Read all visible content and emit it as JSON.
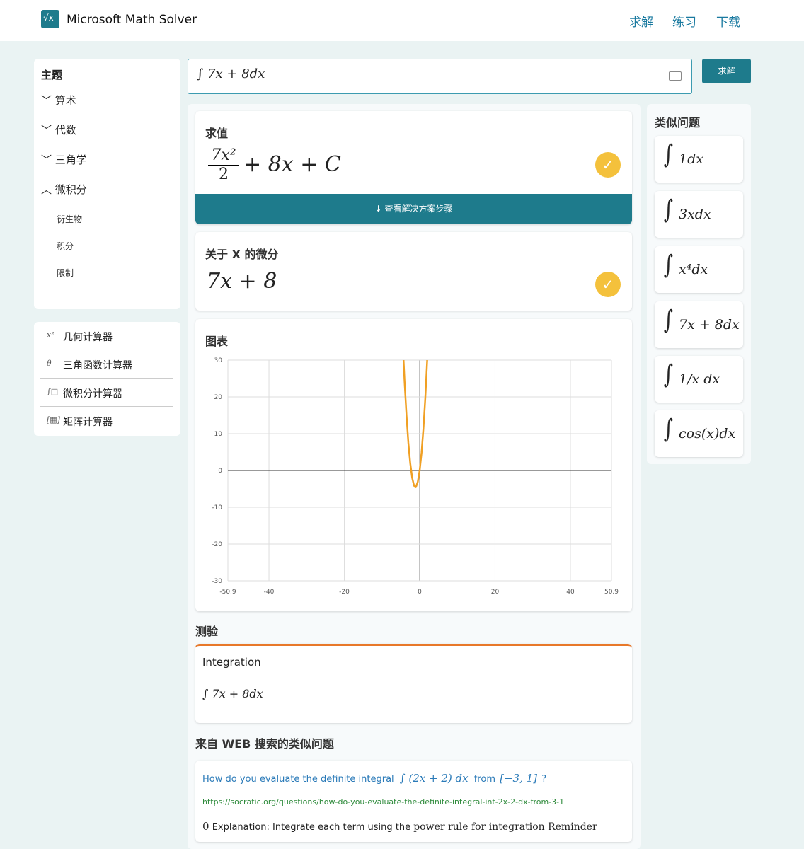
{
  "app": {
    "brand": "Microsoft Math Solver",
    "nav": [
      "求解",
      "练习",
      "下载"
    ]
  },
  "sidebar": {
    "title": "主题",
    "topics": [
      {
        "label": "算术",
        "expanded": false
      },
      {
        "label": "代数",
        "expanded": false
      },
      {
        "label": "三角学",
        "expanded": false
      },
      {
        "label": "微积分",
        "expanded": true
      }
    ],
    "subtopics": [
      "衍生物",
      "积分",
      "限制"
    ],
    "calculators": [
      {
        "icon": "x²",
        "label": "几何计算器"
      },
      {
        "icon": "θ",
        "label": "三角函数计算器"
      },
      {
        "icon": "∫□",
        "label": "微积分计算器"
      },
      {
        "icon": "[▦]",
        "label": "矩阵计算器"
      }
    ]
  },
  "search": {
    "value": "∫ 7x + 8dx",
    "button": "求解",
    "keyboard_icon": "keyboard-icon"
  },
  "evaluate": {
    "title": "求值",
    "result_num": "7x²",
    "result_den": "2",
    "result_rest": "+ 8x + C",
    "steps_button": "查看解决方案步骤"
  },
  "derivative": {
    "title": "关于 X 的微分",
    "result": "7x + 8"
  },
  "chart_title": "图表",
  "chart_data": {
    "type": "line",
    "function": "7x²/2 + 8x",
    "xlim": [
      -50.9,
      50.9
    ],
    "ylim": [
      -30,
      30
    ],
    "x_ticks": [
      "-50.9",
      "-40",
      "-20",
      "0",
      "20",
      "40",
      "50.9"
    ],
    "y_ticks": [
      "30",
      "20",
      "10",
      "0",
      "-10",
      "-20",
      "-30"
    ],
    "grid": true,
    "series": [
      {
        "name": "",
        "color": "#f0a024",
        "x": [
          -5.5,
          -5,
          -4.5,
          -4,
          -3.5,
          -3,
          -2.5,
          -2,
          -1.5,
          -1.143,
          -1,
          -0.5,
          0,
          0.5,
          1,
          1.5,
          2,
          2.5,
          3
        ],
        "y": [
          61.9,
          47.5,
          34.9,
          24,
          14.9,
          7.5,
          1.9,
          -2,
          -4.1,
          -4.57,
          -4.5,
          -3.1,
          0,
          4.9,
          11.5,
          19.9,
          30,
          41.9,
          55.5
        ]
      }
    ]
  },
  "quiz": {
    "title": "测验",
    "card_title": "Integration",
    "expression": "∫ 7x + 8dx"
  },
  "web": {
    "title": "来自 WEB 搜索的类似问题",
    "question_text": "How do you evaluate the definite integral",
    "question_math": "∫ (2x + 2) dx",
    "question_from": "from",
    "question_range": "[−3, 1]",
    "question_end": "?",
    "url": "https://socratic.org/questions/how-do-you-evaluate-the-definite-integral-int-2x-2-dx-from-3-1",
    "snippet_num": "0",
    "snippet_text": "Explanation: Integrate each term using the",
    "snippet_serif": "power rule for integration Reminder"
  },
  "similar": {
    "title": "类似问题",
    "items": [
      "1dx",
      "3xdx",
      "x⁴dx",
      "7x + 8dx",
      "1/x dx",
      "cos(x)dx"
    ]
  }
}
